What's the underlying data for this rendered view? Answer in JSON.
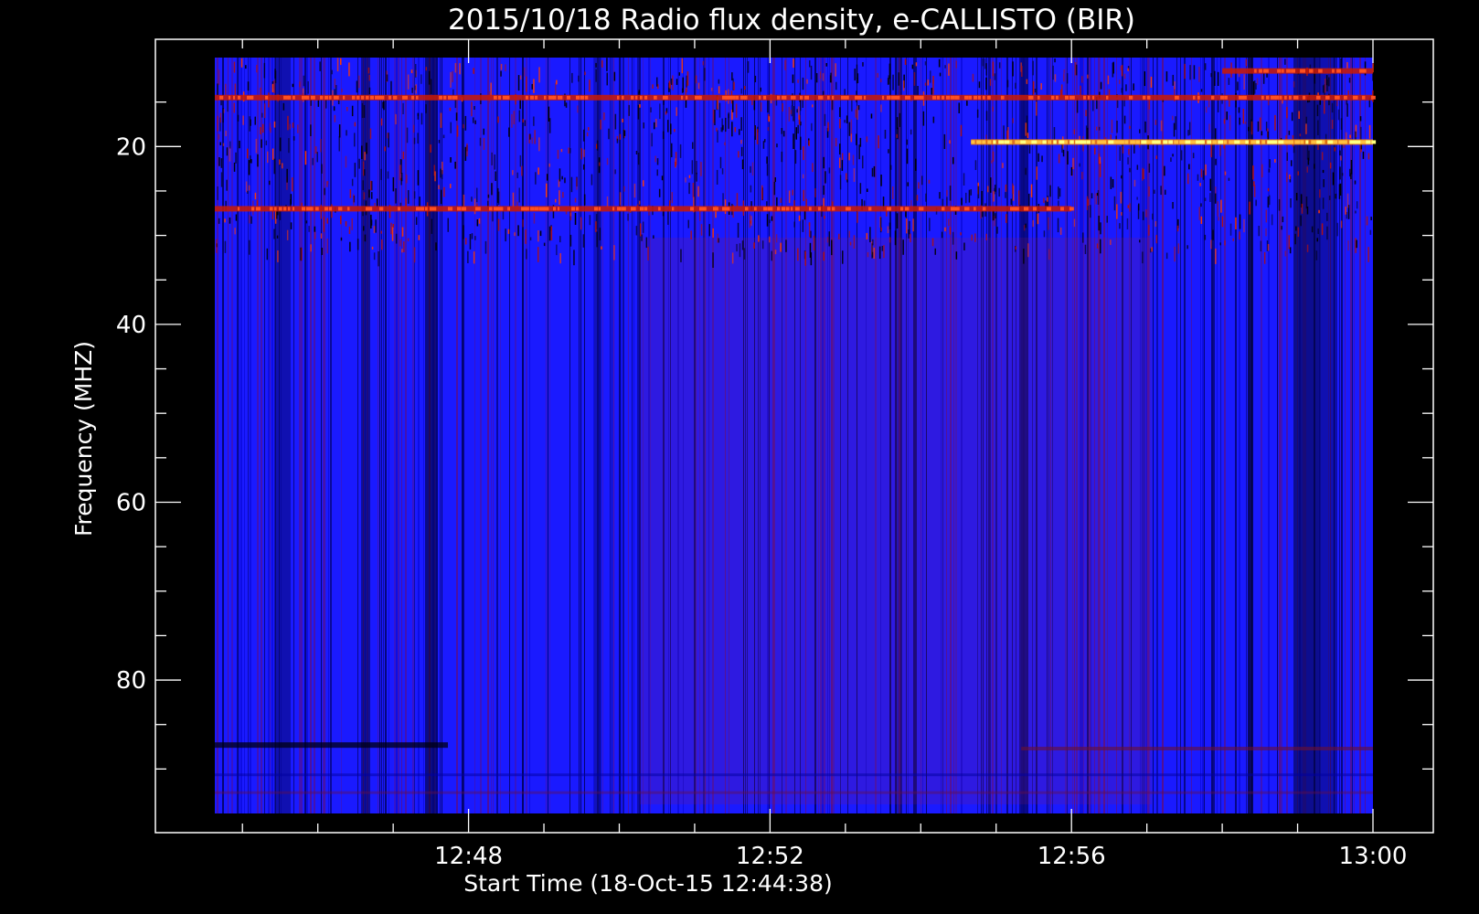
{
  "chart_data": {
    "type": "heatmap",
    "title": "2015/10/18  Radio flux density, e-CALLISTO (BIR)",
    "xlabel": "Start Time (18-Oct-15 12:44:38)",
    "ylabel": "Frequency (MHZ)",
    "x_range": [
      "12:44:38",
      "13:00:00"
    ],
    "y_range": [
      95,
      10
    ],
    "x_ticks": [
      "12:48",
      "12:52",
      "12:56",
      "13:00"
    ],
    "y_ticks": [
      "20",
      "40",
      "60",
      "80"
    ],
    "colormap": [
      "#000000",
      "#0000ff",
      "#8b0000",
      "#ff2000",
      "#ffa000",
      "#ffff80"
    ],
    "background_color": "#1a1aff",
    "axis_color": "#ffffff",
    "features": [
      {
        "name": "interference band",
        "frequency_mhz": 19.5,
        "time_start": "12:54:40",
        "time_end": "13:00:00",
        "intensity": "high"
      },
      {
        "name": "interference band",
        "frequency_mhz": 11.5,
        "time_start": "12:58:00",
        "time_end": "13:00:00",
        "intensity": "medium"
      },
      {
        "name": "interference band",
        "frequency_mhz": 14.5,
        "time_start": "12:44:38",
        "time_end": "13:00:00",
        "intensity": "medium"
      },
      {
        "name": "interference band",
        "frequency_mhz": 27,
        "time_start": "12:44:38",
        "time_end": "12:56:00",
        "intensity": "medium"
      }
    ]
  }
}
